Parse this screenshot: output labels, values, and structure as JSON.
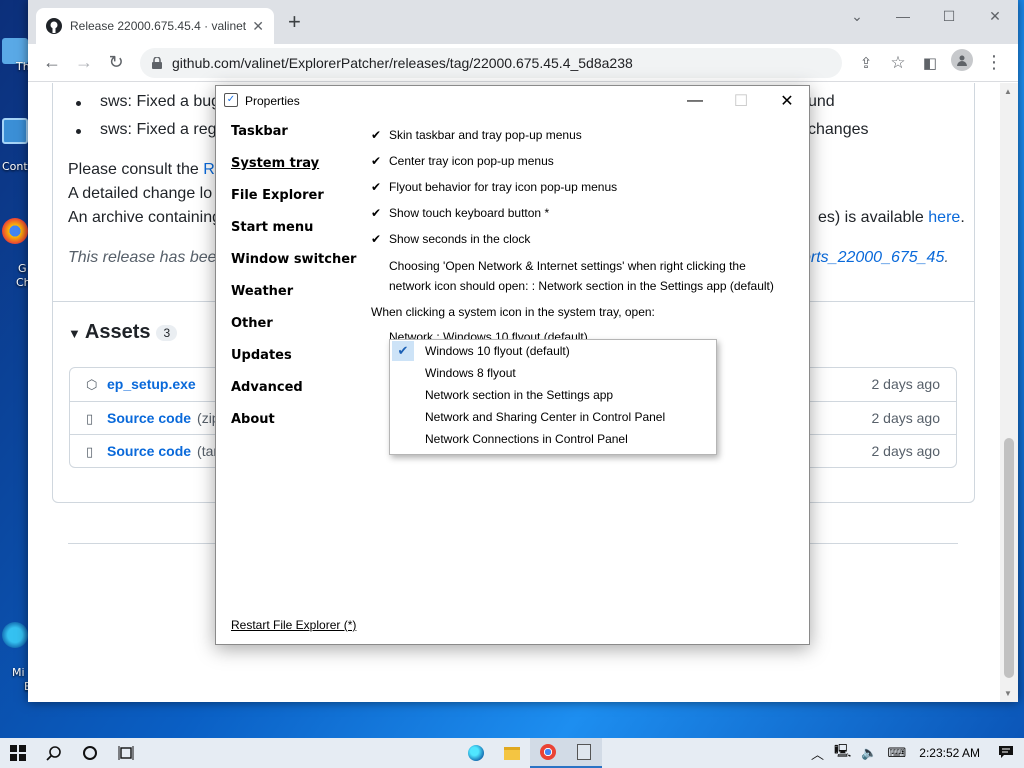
{
  "browser": {
    "tab_title": "Release 22000.675.45.4 · valinet/",
    "url": "github.com/valinet/ExplorerPatcher/releases/tag/22000.675.45.4_5d8a238",
    "close_glyph": "✕",
    "new_tab_glyph": "+",
    "window": {
      "minimize": "—",
      "maximize": "☐",
      "close": "✕"
    }
  },
  "page": {
    "bullets": [
      "sws: Fixed a bug",
      "sws: Fixed a regr"
    ],
    "bullet_tails": [
      "und",
      "changes"
    ],
    "consult_prefix": "Please consult the ",
    "consult_link": "RE",
    "detailed_line": "A detailed change lo",
    "archive_line": "An archive containing",
    "archive_tail": "es) is available ",
    "archive_link": "here",
    "archive_end": ".",
    "release_line": "This release has been",
    "release_link": "orts_22000_675_45",
    "release_end": ".",
    "assets_title": "Assets",
    "assets_count": "3",
    "assets": [
      {
        "name": "ep_setup.exe",
        "ext": "",
        "date": "2 days ago",
        "icon": "package-icon"
      },
      {
        "name": "Source code",
        "ext": "(zip",
        "date": "2 days ago",
        "icon": "file-zip-icon"
      },
      {
        "name": "Source code",
        "ext": "(tar.",
        "date": "2 days ago",
        "icon": "file-zip-icon"
      }
    ]
  },
  "dialog": {
    "title": "Properties",
    "nav": [
      "Taskbar",
      "System tray",
      "File Explorer",
      "Start menu",
      "Window switcher",
      "Weather",
      "Other",
      "Updates",
      "Advanced",
      "About"
    ],
    "active_nav": "System tray",
    "options": [
      {
        "label": "Skin taskbar and tray pop-up menus",
        "checked": true
      },
      {
        "label": "Center tray icon pop-up menus",
        "checked": true
      },
      {
        "label": "Flyout behavior for tray icon pop-up menus",
        "checked": true
      },
      {
        "label": "Show touch keyboard button *",
        "checked": true
      },
      {
        "label": "Show seconds in the clock",
        "checked": true
      }
    ],
    "network_text_1": "Choosing 'Open Network & Internet settings' when right clicking the",
    "network_text_2": "network icon should open: : Network section in the Settings app (default)",
    "system_icon_text": "When clicking a system icon in the system tray, open:",
    "network_select": "Network : Windows 10 flyout (default)",
    "dropdown_options": [
      {
        "label": "Windows 10 flyout (default)",
        "selected": true
      },
      {
        "label": "Windows 8 flyout",
        "selected": false
      },
      {
        "label": "Network section in the Settings app",
        "selected": false
      },
      {
        "label": "Network and Sharing Center in Control Panel",
        "selected": false
      },
      {
        "label": "Network Connections in Control Panel",
        "selected": false
      }
    ],
    "restart_link": "Restart File Explorer (*)",
    "check_glyph": "✔",
    "close_glyph": "✕",
    "min_glyph": "—",
    "max_glyph": "☐"
  },
  "desktop": {
    "labels": [
      "Th",
      "Cont",
      "G",
      "Ch",
      "Mi",
      "E"
    ]
  },
  "taskbar": {
    "clock": "2:23:52 AM",
    "tray_icons": [
      "chevron-up-icon",
      "network-icon",
      "volume-icon",
      "keyboard-icon"
    ],
    "apps": [
      "edge-icon",
      "file-explorer-icon",
      "chrome-icon",
      "explorer-patcher-icon"
    ]
  },
  "colors": {
    "accent": "#0969da",
    "taskbar": "#e6ecf3",
    "desktop": "#0a5fc4",
    "dropdown_selected": "#cde3f7"
  }
}
